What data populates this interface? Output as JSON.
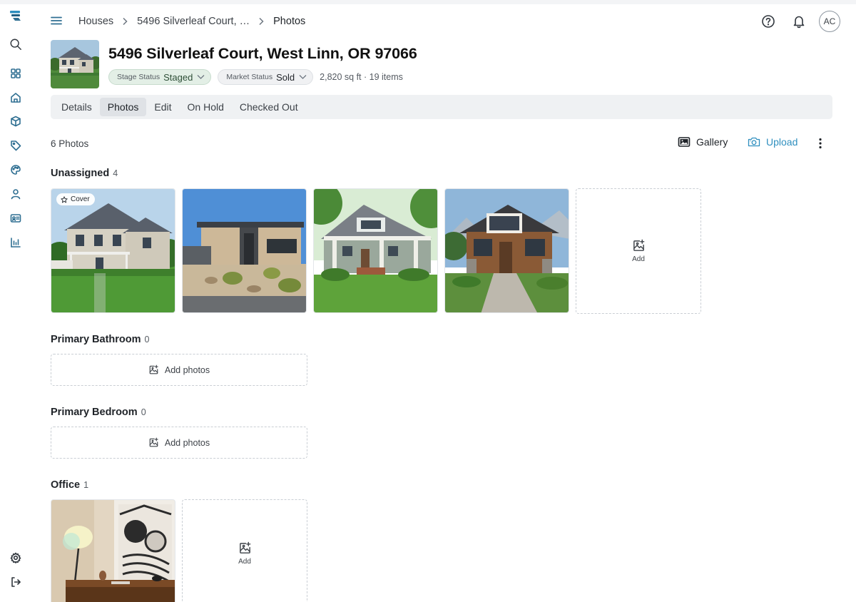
{
  "breadcrumb": {
    "items": [
      "Houses",
      "5496 Silverleaf Court, …",
      "Photos"
    ]
  },
  "user": {
    "initials": "AC"
  },
  "property": {
    "title": "5496 Silverleaf Court, West Linn, OR 97066",
    "stage_status_label": "Stage Status",
    "stage_status_value": "Staged",
    "market_status_label": "Market Status",
    "market_status_value": "Sold",
    "meta": "2,820 sq ft · 19 items"
  },
  "tabs": [
    {
      "label": "Details",
      "active": false
    },
    {
      "label": "Photos",
      "active": true
    },
    {
      "label": "Edit",
      "active": false
    },
    {
      "label": "On Hold",
      "active": false
    },
    {
      "label": "Checked Out",
      "active": false
    }
  ],
  "toolbar": {
    "photo_count": "6 Photos",
    "gallery_label": "Gallery",
    "upload_label": "Upload"
  },
  "sections": [
    {
      "title": "Unassigned",
      "count": "4",
      "cover_label": "Cover",
      "add_label": "Add"
    },
    {
      "title": "Primary Bathroom",
      "count": "0",
      "add_label": "Add photos"
    },
    {
      "title": "Primary Bedroom",
      "count": "0",
      "add_label": "Add photos"
    },
    {
      "title": "Office",
      "count": "1",
      "add_label": "Add"
    }
  ],
  "icons": {
    "rail": [
      "logo-icon",
      "search-icon",
      "dashboard-icon",
      "home-icon",
      "box-icon",
      "tag-icon",
      "palette-icon",
      "user-icon",
      "id-card-icon",
      "bar-chart-icon",
      "gear-icon",
      "logout-icon"
    ],
    "header": [
      "help-icon",
      "bell-icon"
    ]
  },
  "colors": {
    "accent": "#2f8fbf",
    "stage_pill_bg": "#e3efe6",
    "tab_bar_bg": "#eff1f3"
  }
}
